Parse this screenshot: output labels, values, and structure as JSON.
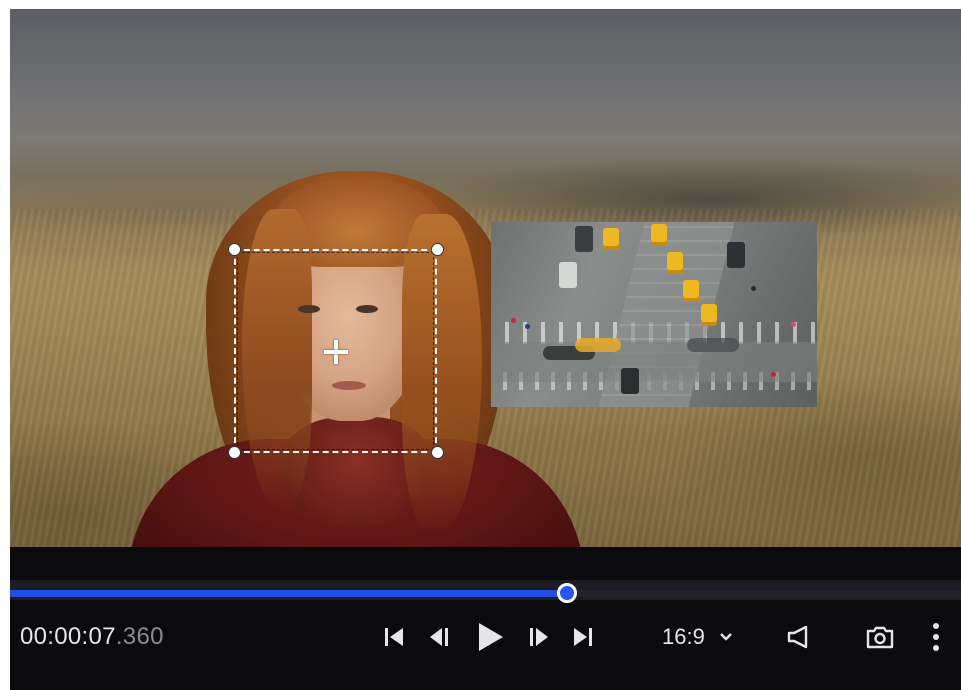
{
  "player": {
    "timecode_main": "00:00:07",
    "timecode_ms": ".360",
    "aspect_ratio": "16:9",
    "progress": 0.586
  },
  "icons": {
    "skip_start": "skip-to-start-icon",
    "frame_back": "step-back-icon",
    "play": "play-icon",
    "frame_forward": "step-forward-icon",
    "skip_end": "skip-to-end-icon",
    "aspect_dropdown": "chevron-down-icon",
    "volume": "speaker-icon",
    "snapshot": "camera-icon",
    "more": "more-vertical-icon"
  },
  "colors": {
    "accent": "#1f4de6",
    "panel": "#0b0b0e",
    "text": "#e6e6ea",
    "text_muted": "#8a8c93"
  }
}
